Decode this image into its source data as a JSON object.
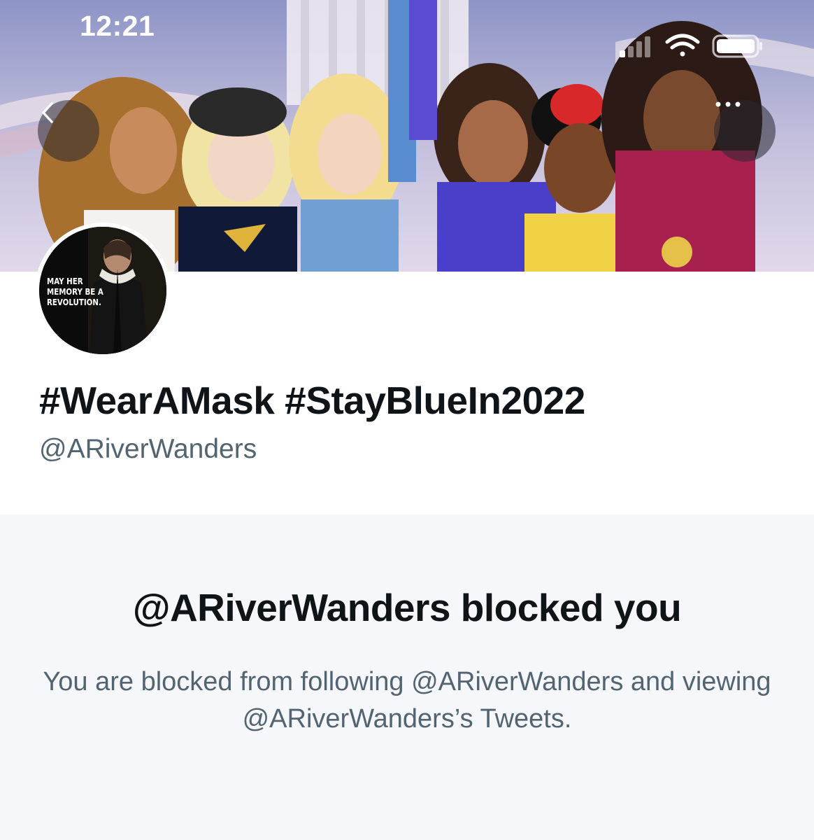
{
  "status_bar": {
    "time": "12:21",
    "icons": [
      "cellular-signal-icon",
      "wifi-icon",
      "battery-icon"
    ]
  },
  "header": {
    "back_icon": "chevron-left-icon",
    "more_icon": "more-horizontal-icon"
  },
  "profile": {
    "avatar_text": "MAY HER\nMEMORY BE A\nREVOLUTION.",
    "display_name": "#WearAMask #StayBlueIn2022",
    "handle": "@ARiverWanders"
  },
  "blocked": {
    "title": "@ARiverWanders blocked you",
    "message": "You are blocked from following @ARiverWanders and viewing @ARiverWanders’s Tweets."
  },
  "colors": {
    "text_primary": "#0f1419",
    "text_secondary": "#536471",
    "panel_background": "#f5f7fa"
  }
}
